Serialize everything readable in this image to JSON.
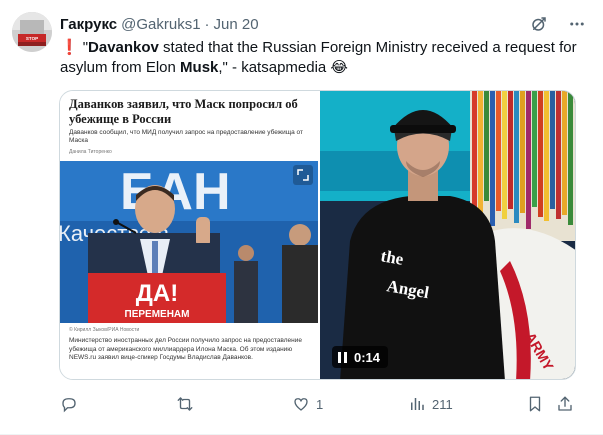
{
  "author": {
    "display_name": "Гакрукс",
    "handle": "@Gakruks1",
    "separator": "·",
    "date": "Jun 20"
  },
  "tweet": {
    "exclamation": "❗",
    "quote_open": "\"",
    "name1": "Davankov",
    "text_part1": " stated that the Russian Foreign Ministry received a request for asylum from Elon ",
    "name2": "Musk",
    "text_part2": ",\" - katsapmedia 😂"
  },
  "media": {
    "article": {
      "headline": "Даванков заявил, что Маск попросил об убежище в России",
      "subhead": "Даванков сообщил, что МИД получил запрос на предоставление убежища от Маска",
      "author": "Данила Титоренко",
      "caption": "© Кирилл Зыков/РИА Новости",
      "body": "Министерство иностранных дел России получило запрос на предоставление убежища от американского миллиардера Илона Маска. Об этом изданию NEWS.ru заявил вице-спикер Госдумы Владислав Даванков.",
      "banner_text": "ДА!",
      "banner_subtext": "ПЕРЕМЕНАМ",
      "bg_text": "Качество в"
    },
    "video": {
      "time": "0:14",
      "shirt_text": "the",
      "shirt_text2": "Angel",
      "sleeve_text": "ARMY"
    }
  },
  "actions": {
    "reply_count": "",
    "retweet_count": "",
    "like_count": "1",
    "views_count": "211"
  },
  "colors": {
    "accent": "#1d9bf0",
    "muted": "#536471",
    "text": "#0f1419",
    "banner_red": "#d42a2a",
    "stage_blue": "#1d6fb8"
  },
  "icons": [
    "grok-icon",
    "more-icon",
    "reply-icon",
    "retweet-icon",
    "like-icon",
    "views-icon",
    "bookmark-icon",
    "share-icon",
    "pause-icon"
  ]
}
